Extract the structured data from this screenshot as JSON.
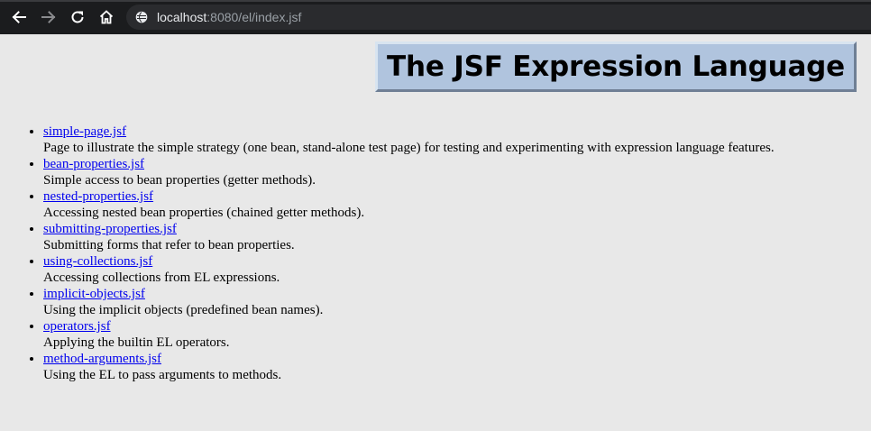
{
  "browser": {
    "url_host": "localhost",
    "url_rest": ":8080/el/index.jsf",
    "back_icon": "arrow-left-icon",
    "forward_icon": "arrow-right-icon",
    "reload_icon": "reload-icon",
    "home_icon": "home-icon",
    "site_info_icon": "globe-info-icon"
  },
  "page": {
    "title": "The JSF Expression Language",
    "items": [
      {
        "link": "simple-page.jsf",
        "description": "Page to illustrate the simple strategy (one bean, stand-alone test page) for testing and experimenting with expression language features."
      },
      {
        "link": "bean-properties.jsf",
        "description": "Simple access to bean properties (getter methods)."
      },
      {
        "link": "nested-properties.jsf",
        "description": "Accessing nested bean properties (chained getter methods)."
      },
      {
        "link": "submitting-properties.jsf",
        "description": "Submitting forms that refer to bean properties."
      },
      {
        "link": "using-collections.jsf",
        "description": "Accessing collections from EL expressions."
      },
      {
        "link": "implicit-objects.jsf",
        "description": "Using the implicit objects (predefined bean names)."
      },
      {
        "link": "operators.jsf",
        "description": "Applying the builtin EL operators."
      },
      {
        "link": "method-arguments.jsf",
        "description": "Using the EL to pass arguments to methods."
      }
    ]
  },
  "colors": {
    "title_background": "#b0c4de",
    "link": "#0000ee",
    "page_background": "#e8e8e8",
    "browser_chrome": "#1b1c1e"
  }
}
